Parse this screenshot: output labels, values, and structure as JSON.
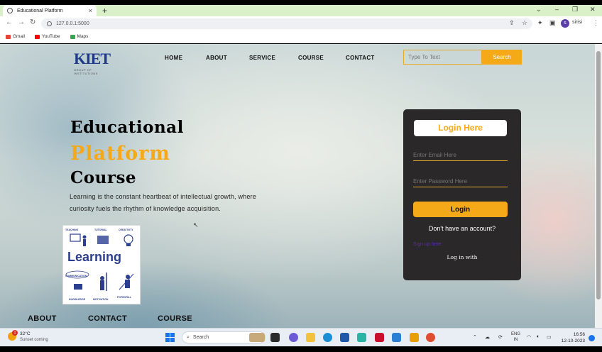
{
  "browser": {
    "tab_title": "Educational Platform",
    "tab_close": "×",
    "new_tab": "+",
    "url": "127.0.0.1:5000",
    "bookmarks": [
      {
        "label": "Gmail",
        "color": "#ea4335"
      },
      {
        "label": "YouTube",
        "color": "#ff0000"
      },
      {
        "label": "Maps",
        "color": "#34a853"
      }
    ],
    "profile_initial": "s",
    "profile_name": "sirisi"
  },
  "header": {
    "logo_text": "KIET",
    "logo_sub": "GROUP OF INSTITUTIONS",
    "nav": [
      "HOME",
      "ABOUT",
      "SERVICE",
      "COURSE",
      "CONTACT"
    ],
    "search_placeholder": "Type To Text",
    "search_button": "Search"
  },
  "hero": {
    "line1": "Educational",
    "line2": "Platform",
    "line3": "Course",
    "description": "Learning is the constant heartbeat of intellectual growth, where curiosity fuels the rhythm of knowledge acquisition."
  },
  "illustration": {
    "word": "Learning",
    "labels": [
      "TEACHING",
      "TUTORIAL",
      "CREATIVITY",
      "COMMUNICATION",
      "KNOWLEDGE",
      "MOTIVATION",
      "POTENTIAL"
    ]
  },
  "login": {
    "title": "Login Here",
    "email_placeholder": "Enter Email Here",
    "password_placeholder": "Enter Password Here",
    "button": "Login",
    "no_account": "Don't have an account?",
    "signup_link": "Sign up here",
    "login_with": "Log in with"
  },
  "footer": {
    "links": [
      "ABOUT",
      "CONTACT",
      "COURSE"
    ]
  },
  "taskbar": {
    "temperature": "32°C",
    "weather": "Sunset coming",
    "weather_badge": "1",
    "search_label": "Search",
    "lang_top": "ENG",
    "lang_bottom": "IN",
    "time": "16:56",
    "date": "12-10-2023"
  },
  "colors": {
    "accent": "#f5a918",
    "card": "#2a2828",
    "logo": "#1e3a8a"
  }
}
